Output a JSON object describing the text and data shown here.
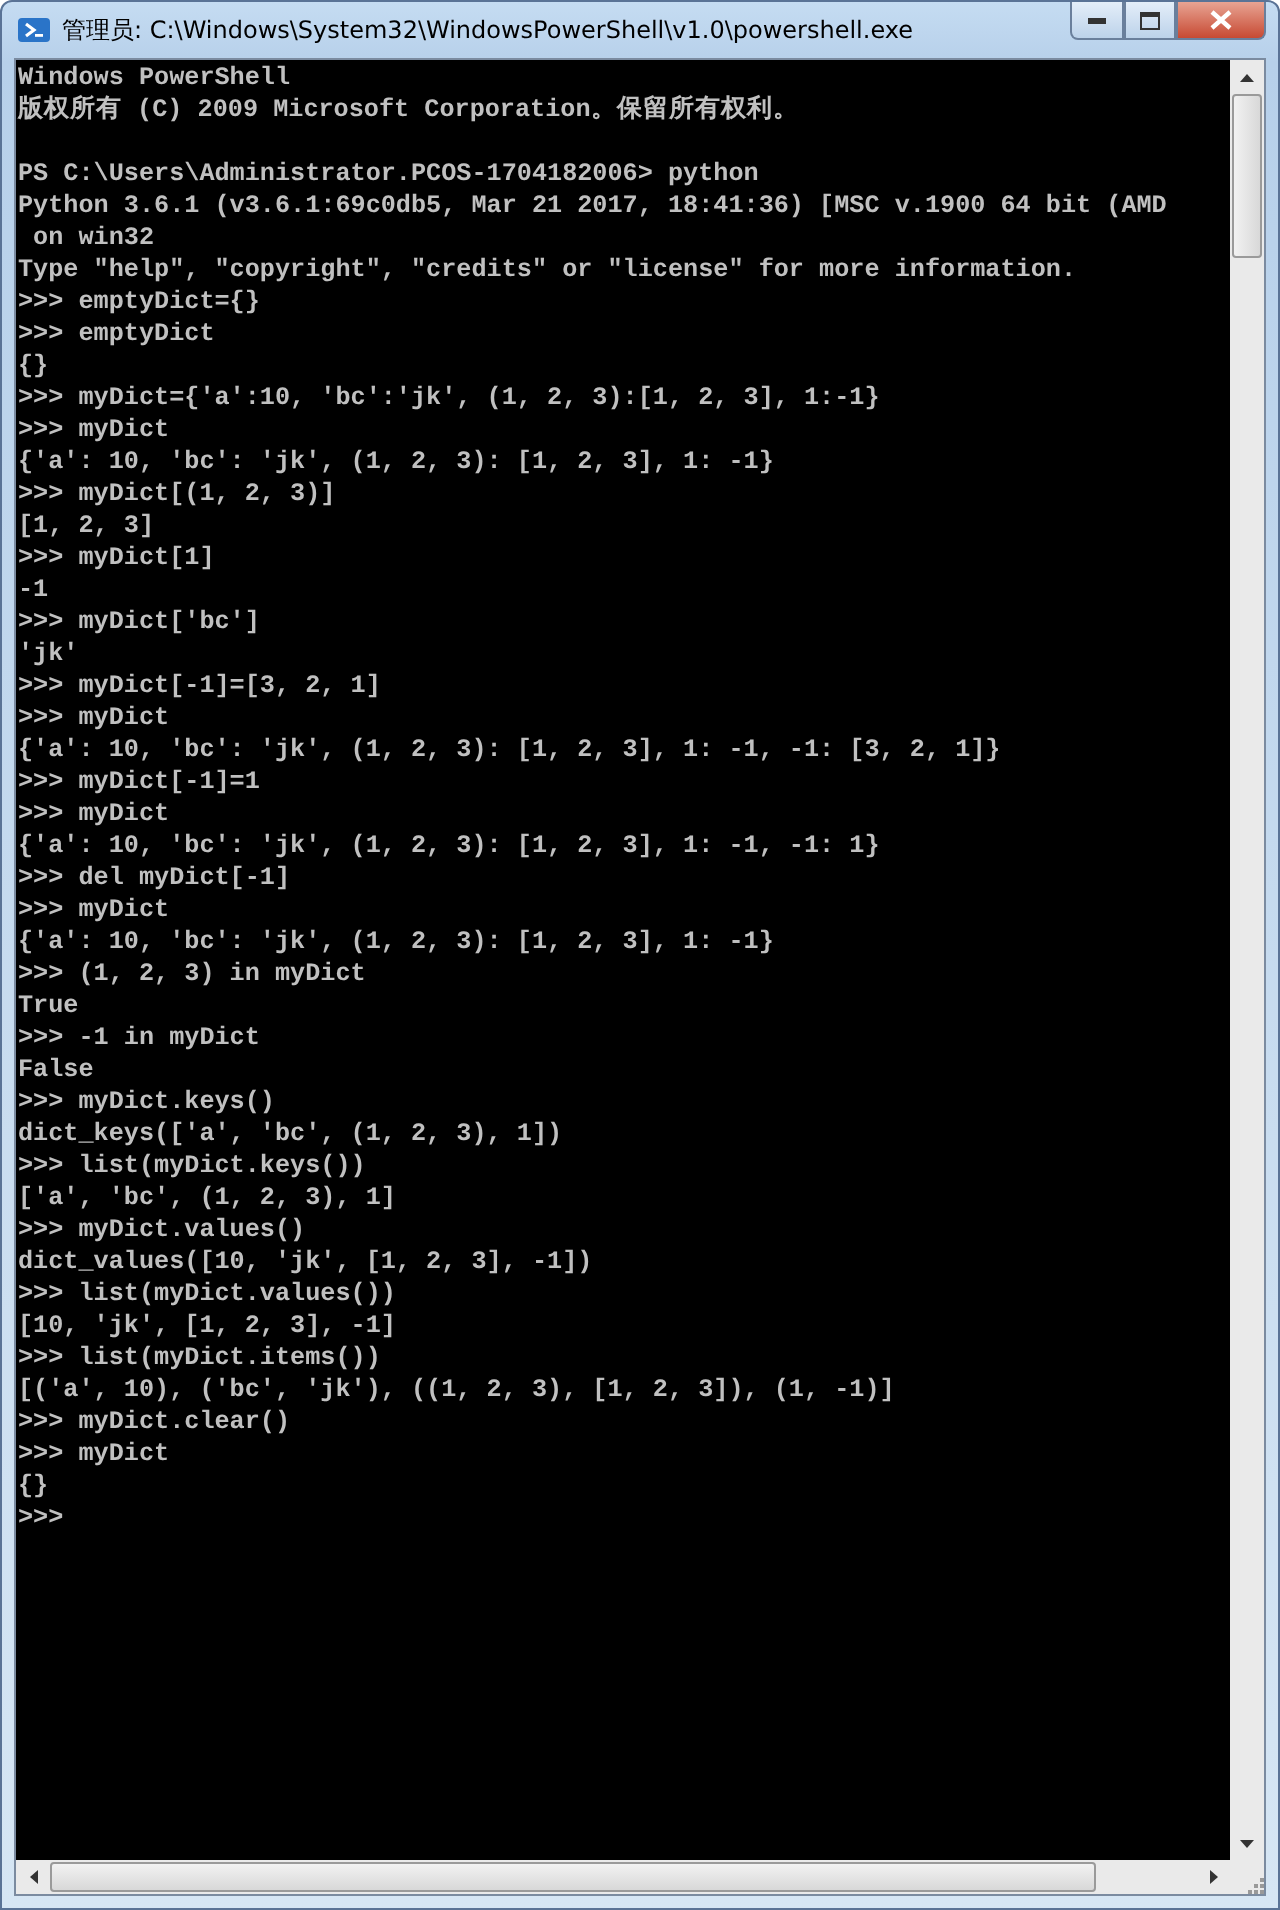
{
  "window": {
    "title": "管理员: C:\\Windows\\System32\\WindowsPowerShell\\v1.0\\powershell.exe"
  },
  "console": {
    "blocks": [
      [
        "Windows PowerShell",
        "版权所有 (C) 2009 Microsoft Corporation。保留所有权利。"
      ],
      [
        "PS C:\\Users\\Administrator.PCOS-1704182006> python",
        "Python 3.6.1 (v3.6.1:69c0db5, Mar 21 2017, 18:41:36) [MSC v.1900 64 bit (AMD",
        " on win32",
        "Type \"help\", \"copyright\", \"credits\" or \"license\" for more information.",
        ">>> emptyDict={}",
        ">>> emptyDict",
        "{}",
        ">>> myDict={'a':10, 'bc':'jk', (1, 2, 3):[1, 2, 3], 1:-1}",
        ">>> myDict",
        "{'a': 10, 'bc': 'jk', (1, 2, 3): [1, 2, 3], 1: -1}",
        ">>> myDict[(1, 2, 3)]",
        "[1, 2, 3]",
        ">>> myDict[1]",
        "-1",
        ">>> myDict['bc']",
        "'jk'",
        ">>> myDict[-1]=[3, 2, 1]",
        ">>> myDict",
        "{'a': 10, 'bc': 'jk', (1, 2, 3): [1, 2, 3], 1: -1, -1: [3, 2, 1]}",
        ">>> myDict[-1]=1",
        ">>> myDict",
        "{'a': 10, 'bc': 'jk', (1, 2, 3): [1, 2, 3], 1: -1, -1: 1}",
        ">>> del myDict[-1]",
        ">>> myDict",
        "{'a': 10, 'bc': 'jk', (1, 2, 3): [1, 2, 3], 1: -1}",
        ">>> (1, 2, 3) in myDict",
        "True",
        ">>> -1 in myDict",
        "False",
        ">>> myDict.keys()",
        "dict_keys(['a', 'bc', (1, 2, 3), 1])",
        ">>> list(myDict.keys())",
        "['a', 'bc', (1, 2, 3), 1]",
        ">>> myDict.values()",
        "dict_values([10, 'jk', [1, 2, 3], -1])",
        ">>> list(myDict.values())",
        "[10, 'jk', [1, 2, 3], -1]",
        ">>> list(myDict.items())",
        "[('a', 10), ('bc', 'jk'), ((1, 2, 3), [1, 2, 3]), (1, -1)]",
        ">>> myDict.clear()",
        ">>> myDict",
        "{}",
        ">>>"
      ]
    ]
  }
}
